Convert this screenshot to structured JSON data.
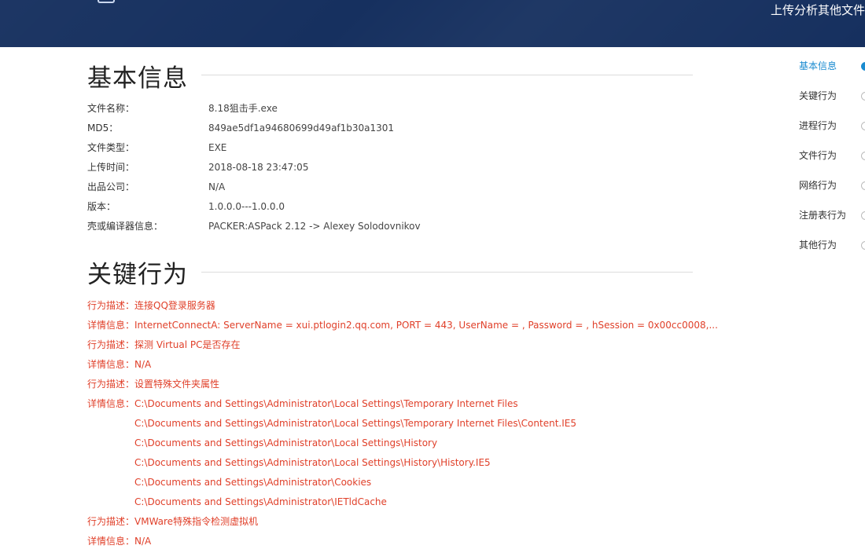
{
  "header": {
    "upload_link": "上传分析其他文件"
  },
  "basic": {
    "title": "基本信息",
    "rows": [
      {
        "label": "文件名称：",
        "value": "8.18狙击手.exe"
      },
      {
        "label": "MD5：",
        "value": "849ae5df1a94680699d49af1b30a1301"
      },
      {
        "label": "文件类型：",
        "value": "EXE"
      },
      {
        "label": "上传时间：",
        "value": "2018-08-18 23:47:05"
      },
      {
        "label": "出品公司：",
        "value": "N/A"
      },
      {
        "label": "版本：",
        "value": "1.0.0.0---1.0.0.0"
      },
      {
        "label": "壳或编译器信息：",
        "value": "PACKER:ASPack 2.12 -> Alexey Solodovnikov"
      }
    ]
  },
  "key_behavior": {
    "title": "关键行为",
    "rows": [
      "行为描述：连接QQ登录服务器",
      "详情信息：InternetConnectA: ServerName = xui.ptlogin2.qq.com, PORT = 443, UserName = , Password = , hSession = 0x00cc0008,...",
      "行为描述：探测 Virtual PC是否存在",
      "详情信息：N/A",
      "行为描述：设置特殊文件夹属性",
      "详情信息：C:\\Documents and Settings\\Administrator\\Local Settings\\Temporary Internet Files",
      "行为描述：VMWare特殊指令检测虚拟机",
      "详情信息：N/A"
    ],
    "detail_extra": [
      "C:\\Documents and Settings\\Administrator\\Local Settings\\Temporary Internet Files\\Content.IE5",
      "C:\\Documents and Settings\\Administrator\\Local Settings\\History",
      "C:\\Documents and Settings\\Administrator\\Local Settings\\History\\History.IE5",
      "C:\\Documents and Settings\\Administrator\\Cookies",
      "C:\\Documents and Settings\\Administrator\\IETldCache"
    ]
  },
  "nav": {
    "items": [
      "基本信息",
      "关键行为",
      "进程行为",
      "文件行为",
      "网络行为",
      "注册表行为",
      "其他行为"
    ],
    "active_index": 0
  },
  "colors": {
    "header_bg": "#16305f",
    "behavior_text": "#e0402a",
    "nav_active": "#1a8bd0"
  }
}
